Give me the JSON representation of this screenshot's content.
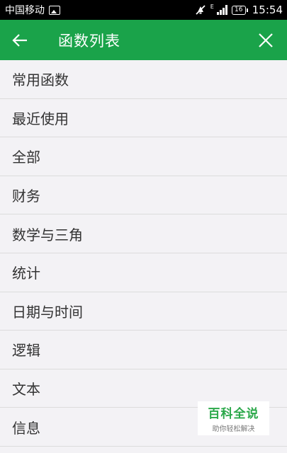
{
  "status_bar": {
    "carrier": "中国移动",
    "network_type": "E",
    "battery_level": "16",
    "time": "15:54",
    "icons": [
      "image-icon",
      "mute-icon",
      "signal-icon",
      "battery-icon"
    ]
  },
  "app_bar": {
    "title": "函数列表",
    "color": "#1aa34a",
    "back_icon": "back-arrow-icon",
    "close_icon": "close-icon"
  },
  "categories": [
    "常用函数",
    "最近使用",
    "全部",
    "财务",
    "数学与三角",
    "统计",
    "日期与时间",
    "逻辑",
    "文本",
    "信息"
  ],
  "watermark": {
    "title": "百科全说",
    "subtitle": "助你轻松解决"
  }
}
